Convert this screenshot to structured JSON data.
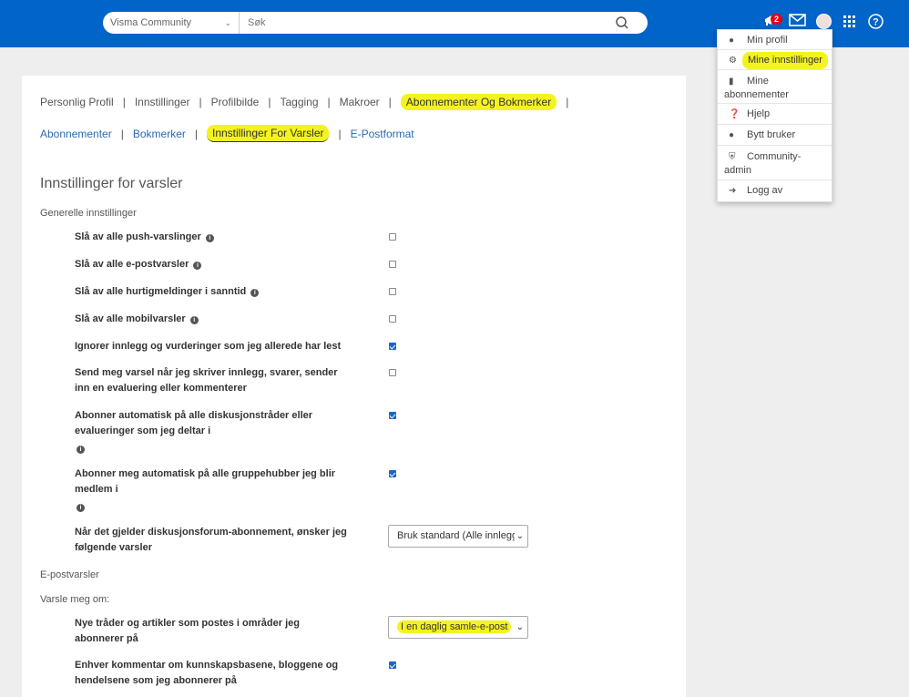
{
  "header": {
    "scope_label": "Visma Community",
    "search_placeholder": "Søk",
    "notification_count": "2"
  },
  "tabs_primary": [
    "Personlig Profil",
    "Innstillinger",
    "Profilbilde",
    "Tagging",
    "Makroer",
    "Abonnementer Og Bokmerker"
  ],
  "tabs_secondary": [
    "Abonnementer",
    "Bokmerker",
    "Innstillinger For Varsler",
    "E-Postformat"
  ],
  "page_title": "Innstillinger for varsler",
  "sections": {
    "general": "Generelle innstillinger",
    "email": "E-postvarsler",
    "notify_about": "Varsle meg om:"
  },
  "settings": [
    {
      "label": "Slå av alle push-varslinger",
      "checked": false
    },
    {
      "label": "Slå av alle e-postvarsler",
      "checked": false
    },
    {
      "label": "Slå av alle hurtigmeldinger i sanntid",
      "checked": false
    },
    {
      "label": "Slå av alle mobilvarsler",
      "checked": false
    },
    {
      "label": "Ignorer innlegg og vurderinger som jeg allerede har lest",
      "checked": true
    },
    {
      "label": "Send meg varsel når jeg skriver innlegg, svarer, sender inn en evaluering eller kommenterer",
      "checked": false
    },
    {
      "label": "Abonner automatisk på alle diskusjonstråder eller evalueringer som jeg deltar i",
      "checked": true
    },
    {
      "label": "Abonner meg automatisk på alle gruppehubber jeg blir medlem i",
      "checked": true
    },
    {
      "label": "Når det gjelder diskusjonsforum-abonnement, ønsker jeg følgende varsler",
      "select": "Bruk standard (Alle innlegg)"
    },
    {
      "label": "Nye tråder og artikler som postes i områder jeg abonnerer på",
      "select": "I en daglig samle-e-post"
    },
    {
      "label": "Enhver kommentar om kunnskapsbasene, bloggene og hendelsene som jeg abonnerer på",
      "checked": true
    }
  ],
  "user_menu": [
    "Min profil",
    "Mine innstillinger",
    "Mine abonnementer",
    "Hjelp",
    "Bytt bruker",
    "Community-admin",
    "Logg av"
  ],
  "colors": {
    "topbar": "#0064c8",
    "highlight": "#f4f321",
    "checkbox_on": "#1a66c8"
  }
}
